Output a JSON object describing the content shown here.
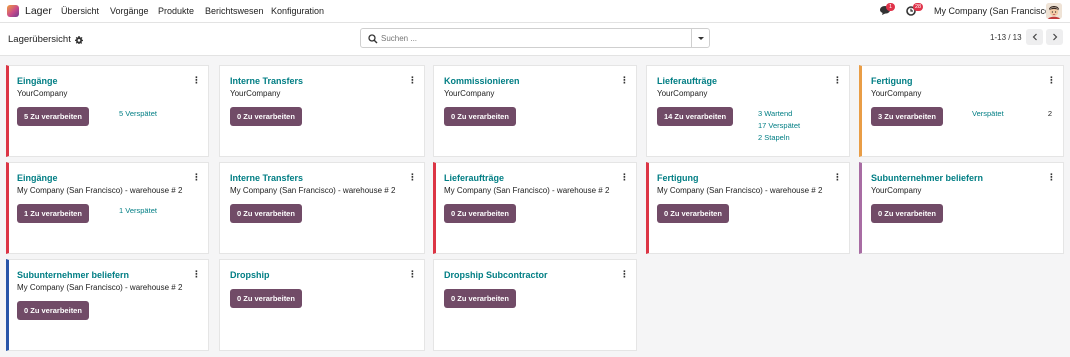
{
  "nav": {
    "app_name": "Lager",
    "menu": [
      "Übersicht",
      "Vorgänge",
      "Produkte",
      "Berichtswesen",
      "Konfiguration"
    ],
    "messages_badge": "1",
    "activities_badge": "28",
    "company": "My Company (San Francisco)"
  },
  "control_panel": {
    "breadcrumb": "Lagerübersicht",
    "search_placeholder": "Suchen ...",
    "pager": "1-13 / 13"
  },
  "colors": {
    "brand": "#714b67",
    "link": "#017e84",
    "orange": "#e99d46",
    "red": "#dc3545",
    "purple": "#a86ca3",
    "blue": "#2854a8"
  },
  "cards": [
    {
      "title": "Eingänge",
      "subtitle": "YourCompany",
      "button": "5 Zu verarbeiten",
      "stats": [
        "5 Verspätet"
      ],
      "count": ""
    },
    {
      "title": "Interne Transfers",
      "subtitle": "YourCompany",
      "button": "0 Zu verarbeiten",
      "stats": [],
      "count": ""
    },
    {
      "title": "Kommissionieren",
      "subtitle": "YourCompany",
      "button": "0 Zu verarbeiten",
      "stats": [],
      "count": ""
    },
    {
      "title": "Lieferaufträge",
      "subtitle": "YourCompany",
      "button": "14 Zu verarbeiten",
      "stats": [
        "3 Wartend",
        "17 Verspätet",
        "2 Stapeln"
      ],
      "count": ""
    },
    {
      "title": "Fertigung",
      "subtitle": "YourCompany",
      "button": "3 Zu verarbeiten",
      "stats": [
        "Verspätet"
      ],
      "count": "2"
    },
    {
      "title": "Eingänge",
      "subtitle": "My Company (San Francisco) - warehouse # 2",
      "button": "1 Zu verarbeiten",
      "stats": [
        "1 Verspätet"
      ],
      "count": ""
    },
    {
      "title": "Interne Transfers",
      "subtitle": "My Company (San Francisco) - warehouse # 2",
      "button": "0 Zu verarbeiten",
      "stats": [],
      "count": ""
    },
    {
      "title": "Lieferaufträge",
      "subtitle": "My Company (San Francisco) - warehouse # 2",
      "button": "0 Zu verarbeiten",
      "stats": [],
      "count": ""
    },
    {
      "title": "Fertigung",
      "subtitle": "My Company (San Francisco) - warehouse # 2",
      "button": "0 Zu verarbeiten",
      "stats": [],
      "count": ""
    },
    {
      "title": "Subunternehmer beliefern",
      "subtitle": "YourCompany",
      "button": "0 Zu verarbeiten",
      "stats": [],
      "count": ""
    },
    {
      "title": "Subunternehmer beliefern",
      "subtitle": "My Company (San Francisco) - warehouse # 2",
      "button": "0 Zu verarbeiten",
      "stats": [],
      "count": ""
    },
    {
      "title": "Dropship",
      "subtitle": "",
      "button": "0 Zu verarbeiten",
      "stats": [],
      "count": ""
    },
    {
      "title": "Dropship Subcontractor",
      "subtitle": "",
      "button": "0 Zu verarbeiten",
      "stats": [],
      "count": ""
    }
  ]
}
